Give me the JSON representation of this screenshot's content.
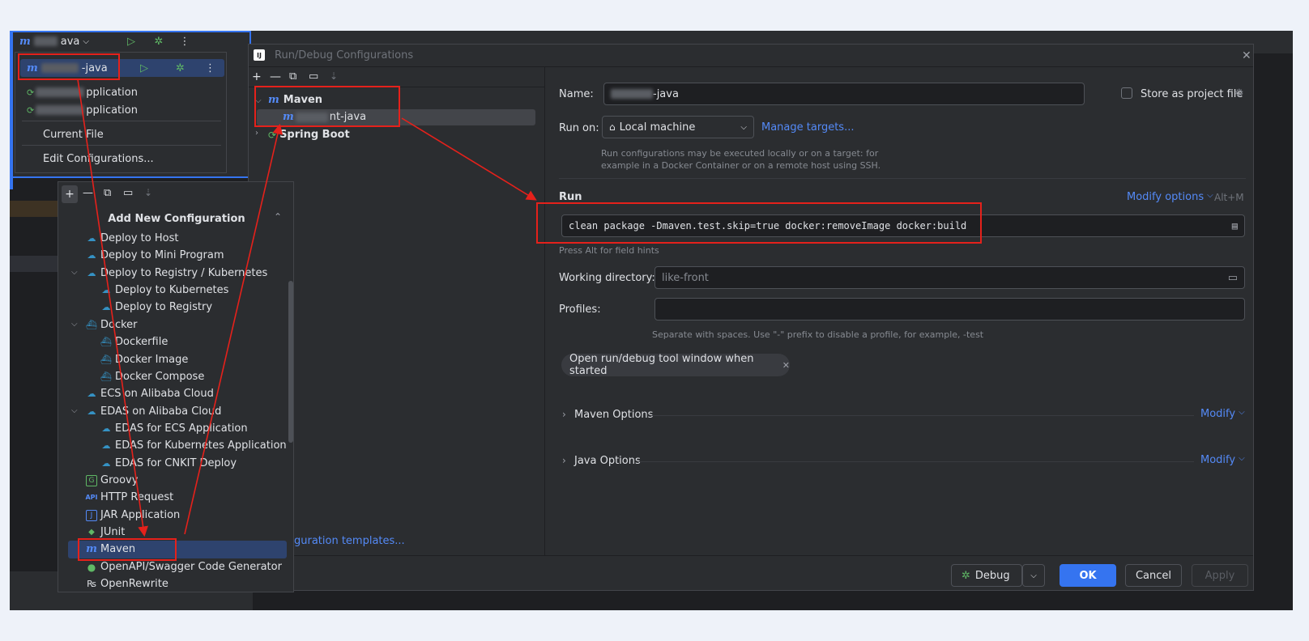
{
  "ide": {
    "run_config_name_suffix": "ava",
    "run_selector_chevron": "⌵"
  },
  "run_dropdown": {
    "selected_item": "-java",
    "items": [
      {
        "label": "pplication"
      },
      {
        "label": "pplication"
      }
    ],
    "current_file": "Current File",
    "edit_configurations": "Edit Configurations..."
  },
  "dialog": {
    "title": "Run/Debug Configurations",
    "app_icon": "IJ",
    "tree": {
      "maven_group": "Maven",
      "maven_child_suffix": "nt-java",
      "spring_boot_group": "Spring Boot"
    },
    "templates_link": "guration templates...",
    "name_label": "Name:",
    "name_value_suffix": "-java",
    "store_as_project_file": "Store as project file",
    "run_on_label": "Run on:",
    "run_on_value": "Local machine",
    "manage_targets": "Manage targets...",
    "run_on_hint_line1": "Run configurations may be executed locally or on a target: for",
    "run_on_hint_line2": "example in a Docker Container or on a remote host using SSH.",
    "run_section": "Run",
    "modify_options": "Modify options",
    "modify_options_shortcut": "Alt+M",
    "command_line": "clean package -Dmaven.test.skip=true docker:removeImage docker:build",
    "field_hint": "Press Alt for field hints",
    "working_directory_label": "Working directory:",
    "working_directory_value": "like-front",
    "profiles_label": "Profiles:",
    "profiles_value": "",
    "profiles_hint": "Separate with spaces. Use \"-\" prefix to disable a profile, for example, -test",
    "chip_label": "Open run/debug tool window when started",
    "maven_options": "Maven Options",
    "java_options": "Java Options",
    "modify": "Modify",
    "footer": {
      "debug": "Debug",
      "ok": "OK",
      "cancel": "Cancel",
      "apply": "Apply"
    }
  },
  "add_new_configuration": {
    "title": "Add New Configuration",
    "items": [
      {
        "label": "Deploy to Host",
        "icon": "cloud-upload-icon"
      },
      {
        "label": "Deploy to Mini Program",
        "icon": "cloud-upload-icon"
      },
      {
        "label": "Deploy to Registry / Kubernetes",
        "icon": "cloud-upload-icon"
      },
      {
        "label": "Deploy to Kubernetes",
        "icon": "cloud-upload-icon"
      },
      {
        "label": "Deploy to Registry",
        "icon": "cloud-upload-icon"
      },
      {
        "label": "Docker",
        "icon": "docker-icon"
      },
      {
        "label": "Dockerfile",
        "icon": "docker-icon"
      },
      {
        "label": "Docker Image",
        "icon": "docker-icon"
      },
      {
        "label": "Docker Compose",
        "icon": "docker-icon"
      },
      {
        "label": "ECS on Alibaba Cloud",
        "icon": "cloud-upload-icon"
      },
      {
        "label": "EDAS on Alibaba Cloud",
        "icon": "cloud-upload-icon"
      },
      {
        "label": "EDAS for ECS Application",
        "icon": "cloud-upload-icon"
      },
      {
        "label": "EDAS for Kubernetes Application",
        "icon": "cloud-upload-icon"
      },
      {
        "label": "EDAS for CNKIT Deploy",
        "icon": "cloud-upload-icon"
      },
      {
        "label": "Groovy",
        "icon": "groovy-icon"
      },
      {
        "label": "HTTP Request",
        "icon": "http-api-icon"
      },
      {
        "label": "JAR Application",
        "icon": "jar-icon"
      },
      {
        "label": "JUnit",
        "icon": "junit-icon"
      },
      {
        "label": "Maven",
        "icon": "maven-icon"
      },
      {
        "label": "OpenAPI/Swagger Code Generator",
        "icon": "openapi-icon"
      },
      {
        "label": "OpenRewrite",
        "icon": "openrewrite-icon"
      }
    ]
  },
  "colors": {
    "accent": "#3574f0",
    "annotation_red": "#e5211b",
    "dialog_bg": "#2b2d30",
    "editor_bg": "#1e1f22"
  }
}
